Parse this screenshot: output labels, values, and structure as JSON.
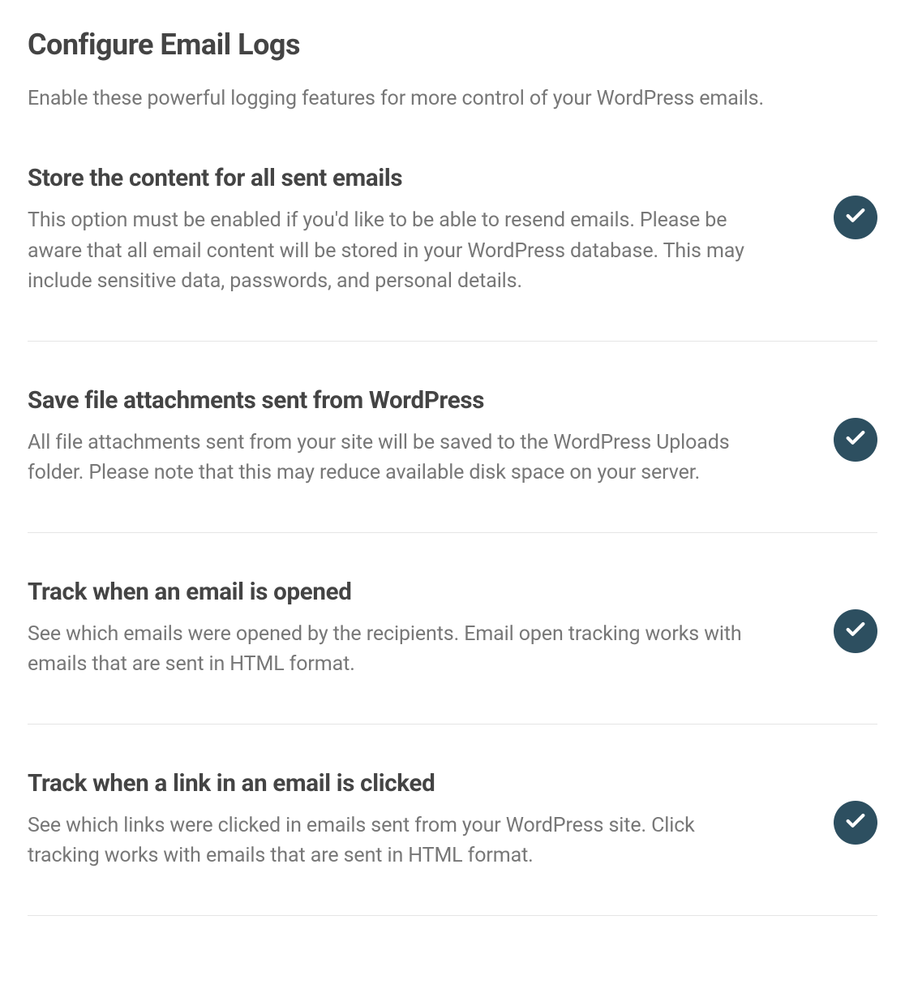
{
  "header": {
    "title": "Configure Email Logs",
    "subtitle": "Enable these powerful logging features for more control of your WordPress emails."
  },
  "options": [
    {
      "title": "Store the content for all sent emails",
      "description": "This option must be enabled if you'd like to be able to resend emails. Please be aware that all email content will be stored in your WordPress database. This may include sensitive data, passwords, and personal details.",
      "enabled": true
    },
    {
      "title": "Save file attachments sent from WordPress",
      "description": "All file attachments sent from your site will be saved to the WordPress Uploads folder. Please note that this may reduce available disk space on your server.",
      "enabled": true
    },
    {
      "title": "Track when an email is opened",
      "description": "See which emails were opened by the recipients. Email open tracking works with emails that are sent in HTML format.",
      "enabled": true
    },
    {
      "title": "Track when a link in an email is clicked",
      "description": "See which links were clicked in emails sent from your WordPress site. Click tracking works with emails that are sent in HTML format.",
      "enabled": true
    }
  ],
  "colors": {
    "toggle_on": "#2d4f60"
  }
}
